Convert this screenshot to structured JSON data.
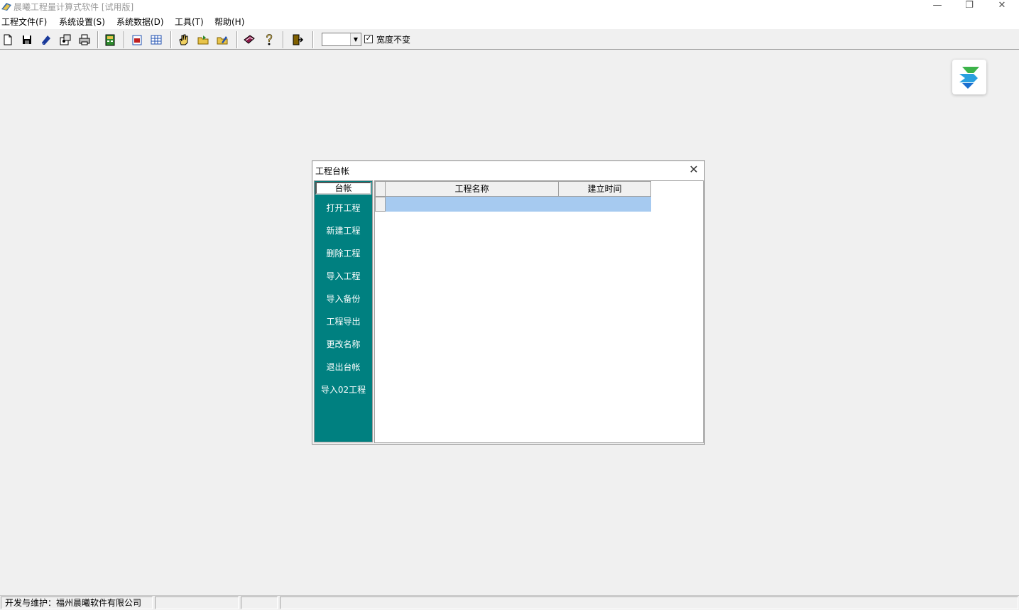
{
  "window": {
    "title": "晨曦工程量计算式软件 [试用版]",
    "minimize": "—",
    "restore": "❐",
    "close": "✕"
  },
  "menu": [
    "工程文件(F)",
    "系统设置(S)",
    "系统数据(D)",
    "工具(T)",
    "帮助(H)"
  ],
  "toolbar": {
    "icons": [
      "new-file-icon",
      "save-icon",
      "edit-icon",
      "properties-icon",
      "print-icon",
      "calculator-icon",
      "form-icon",
      "table-icon",
      "hand-icon",
      "open-folder-icon",
      "edit-folder-icon",
      "book-icon",
      "help-icon",
      "exit-icon"
    ],
    "combo_value": "",
    "width_fixed_checked": true,
    "width_fixed_label": "宽度不变"
  },
  "dialog": {
    "title": "工程台帐",
    "close": "✕",
    "sidebar": {
      "header": "台帐",
      "items": [
        "打开工程",
        "新建工程",
        "删除工程",
        "导入工程",
        "导入备份",
        "工程导出",
        "更改名称",
        "退出台帐",
        "导入02工程"
      ]
    },
    "grid": {
      "columns": [
        "工程名称",
        "建立时间"
      ],
      "rows": [
        [
          "",
          ""
        ]
      ]
    }
  },
  "status": {
    "developer": "开发与维护：福州晨曦软件有限公司",
    "pane2": "",
    "pane3": "",
    "pane4": ""
  },
  "colors": {
    "sidebar_bg": "#008080",
    "selected_row": "#a6caf0"
  }
}
